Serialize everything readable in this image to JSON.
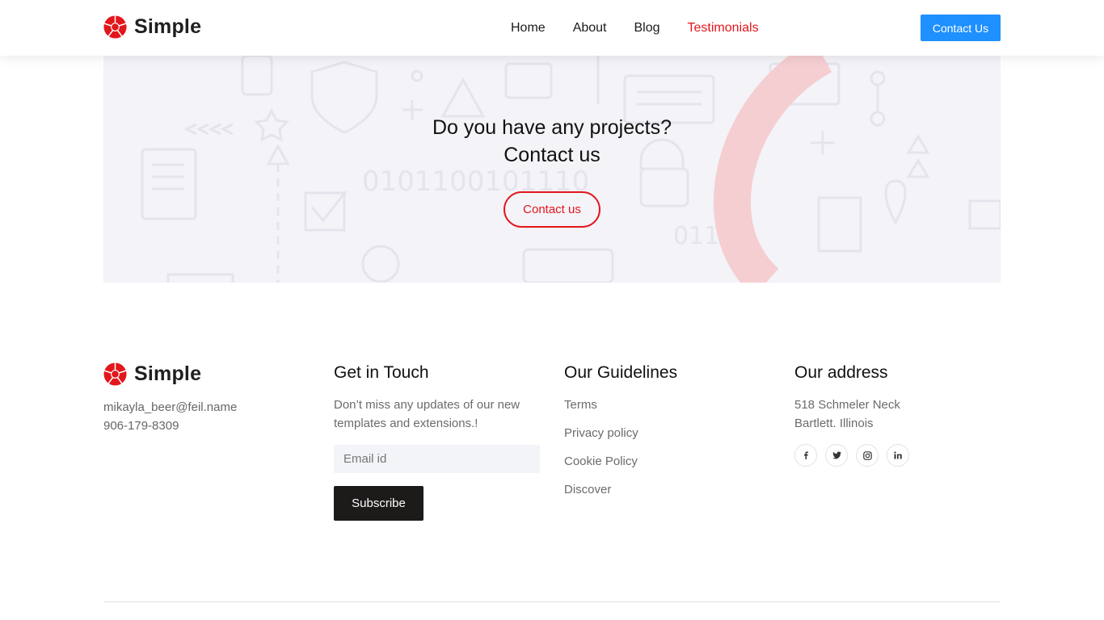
{
  "brand": {
    "name": "Simple",
    "accent_color": "#e3161b",
    "logo_icon": "aperture-icon"
  },
  "nav": {
    "items": [
      {
        "label": "Home",
        "active": false
      },
      {
        "label": "About",
        "active": false
      },
      {
        "label": "Blog",
        "active": false
      },
      {
        "label": "Testimonials",
        "active": true
      }
    ],
    "cta_label": "Contact Us",
    "cta_color": "#1e90ff"
  },
  "cta": {
    "title_line1": "Do you have any projects?",
    "title_line2": "Contact us",
    "button_label": "Contact us"
  },
  "footer": {
    "contact": {
      "email": "mikayla_beer@feil.name",
      "phone": "906-179-8309"
    },
    "touch": {
      "heading": "Get in Touch",
      "text": "Don’t miss any updates of our new templates and extensions.!",
      "email_placeholder": "Email id",
      "subscribe_label": "Subscribe"
    },
    "guidelines": {
      "heading": "Our Guidelines",
      "links": [
        "Terms",
        "Privacy policy",
        "Cookie Policy",
        "Discover"
      ]
    },
    "address": {
      "heading": "Our address",
      "line1": "518 Schmeler Neck",
      "line2": "Bartlett. Illinois",
      "socials": [
        {
          "icon": "facebook-icon",
          "glyph": "f"
        },
        {
          "icon": "twitter-icon",
          "glyph": "t"
        },
        {
          "icon": "instagram-icon",
          "glyph": "◎"
        },
        {
          "icon": "linkedin-icon",
          "glyph": "in"
        }
      ]
    }
  }
}
